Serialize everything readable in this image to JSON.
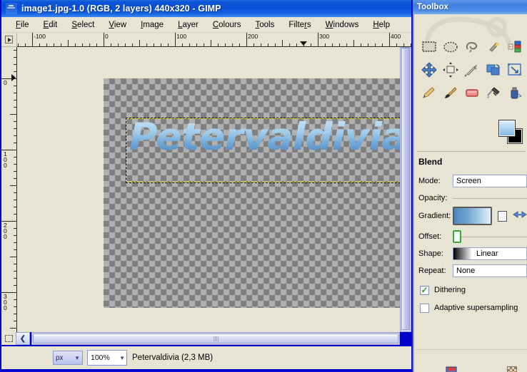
{
  "image_window": {
    "title": "image1.jpg-1.0 (RGB, 2 layers) 440x320 - GIMP",
    "title_icon": "gimp-wilber-icon",
    "menus": [
      {
        "label": "File",
        "mnemonic": "F"
      },
      {
        "label": "Edit",
        "mnemonic": "E"
      },
      {
        "label": "Select",
        "mnemonic": "S"
      },
      {
        "label": "View",
        "mnemonic": "V"
      },
      {
        "label": "Image",
        "mnemonic": "I"
      },
      {
        "label": "Layer",
        "mnemonic": "L"
      },
      {
        "label": "Colours",
        "mnemonic": "C"
      },
      {
        "label": "Tools",
        "mnemonic": "T"
      },
      {
        "label": "Filters",
        "mnemonic": "r"
      },
      {
        "label": "Windows",
        "mnemonic": "W"
      },
      {
        "label": "Help",
        "mnemonic": "H"
      }
    ],
    "h_ruler": {
      "labels": [
        "-100",
        "0",
        "100",
        "200",
        "300",
        "400"
      ],
      "marker_value": 280
    },
    "v_ruler": {
      "labels": [
        "0",
        "100",
        "200",
        "300"
      ]
    },
    "canvas": {
      "artwork_text": "Petervaldivia",
      "image_size": "440x320",
      "background": "transparent-checkerboard"
    },
    "statusbar": {
      "unit": "px",
      "zoom": "100%",
      "message": "Petervaldivia (2,3 MB)"
    },
    "quick_mask_tooltip": "Toggle Quick Mask",
    "nav_button_label": "❮"
  },
  "toolbox": {
    "title": "Toolbox",
    "tools": [
      {
        "name": "rect-select-tool",
        "label": "Rectangle Select"
      },
      {
        "name": "ellipse-select-tool",
        "label": "Ellipse Select"
      },
      {
        "name": "free-select-tool",
        "label": "Free Select"
      },
      {
        "name": "fuzzy-select-tool",
        "label": "Fuzzy Select"
      },
      {
        "name": "select-by-color-tool",
        "label": "Select by Colour"
      },
      {
        "name": "move-tool",
        "label": "Move"
      },
      {
        "name": "align-tool",
        "label": "Alignment"
      },
      {
        "name": "crop-tool",
        "label": "Crop"
      },
      {
        "name": "rotate-tool",
        "label": "Rotate"
      },
      {
        "name": "scale-tool",
        "label": "Scale"
      },
      {
        "name": "pencil-tool",
        "label": "Pencil"
      },
      {
        "name": "paintbrush-tool",
        "label": "Paintbrush"
      },
      {
        "name": "eraser-tool",
        "label": "Eraser"
      },
      {
        "name": "airbrush-tool",
        "label": "Airbrush"
      },
      {
        "name": "ink-tool",
        "label": "Ink"
      }
    ],
    "foreground_color": "#8fc0e4",
    "background_color": "#000000",
    "options": {
      "title": "Blend",
      "mode_label": "Mode:",
      "mode_value": "Screen",
      "opacity_label": "Opacity:",
      "gradient_label": "Gradient:",
      "gradient_colors": [
        "#4f86bc",
        "#e6f2fa"
      ],
      "reverse_icon": "reverse-arrows-icon",
      "offset_label": "Offset:",
      "shape_label": "Shape:",
      "shape_value": "Linear",
      "repeat_label": "Repeat:",
      "repeat_value": "None",
      "dithering_label": "Dithering",
      "dithering_checked": true,
      "supersampling_label": "Adaptive supersampling",
      "supersampling_checked": false
    },
    "footer": {
      "save_icon": "save-device-status-icon",
      "reset_icon": "reset-pattern-icon"
    }
  },
  "theme": {
    "titlebar_blue": "#0a4fd4",
    "panel_beige": "#e8e4d4",
    "accent_blue": "#4f86bc"
  }
}
